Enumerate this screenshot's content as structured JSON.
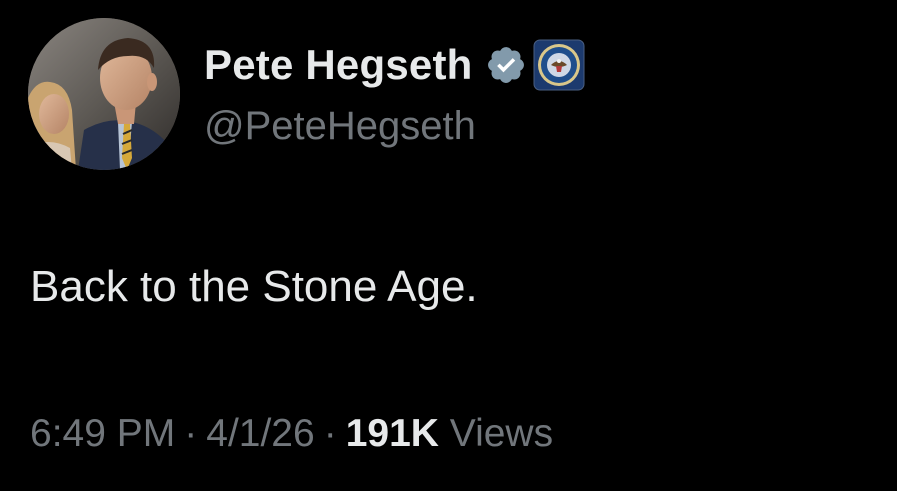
{
  "author": {
    "display_name": "Pete Hegseth",
    "handle": "@PeteHegseth",
    "avatar_icon": "profile-photo",
    "verified_icon": "verified-badge-icon",
    "affiliation_icon": "department-seal-icon"
  },
  "tweet": {
    "text": "Back to the Stone Age."
  },
  "meta": {
    "time": "6:49 PM",
    "separator": "·",
    "date": "4/1/26",
    "views_count": "191K",
    "views_label": "Views"
  },
  "colors": {
    "background": "#000000",
    "primary_text": "#e7e9ea",
    "secondary_text": "#71767b",
    "verified_badge": "#829aab",
    "seal_blue": "#1c3a6e"
  }
}
